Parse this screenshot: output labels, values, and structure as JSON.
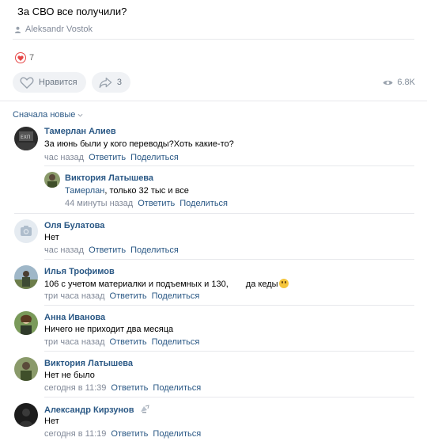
{
  "post": {
    "title": "За СВО все получили?",
    "author": "Aleksandr Vostok",
    "likes_count": "7",
    "like_label": "Нравится",
    "share_count": "3",
    "views": "6.8K"
  },
  "sort_label": "Сначала новые",
  "comments": [
    {
      "name": "Тамерлан Алиев",
      "text": "За июнь были у кого переводы?Хоть какие-то?",
      "time": "час назад",
      "reply": "Ответить",
      "share": "Поделиться"
    },
    {
      "name": "Виктория Латышева",
      "mention": "Тамерлан",
      "text": ", только 32 тыс и все",
      "time": "44 минуты назад",
      "reply": "Ответить",
      "share": "Поделиться"
    },
    {
      "name": "Оля Булатова",
      "text": "Нет",
      "time": "час назад",
      "reply": "Ответить",
      "share": "Поделиться"
    },
    {
      "name": "Илья Трофимов",
      "text": "106 с учетом материалки и подъемных и 130,",
      "text2": "да кеды",
      "time": "три часа назад",
      "reply": "Ответить",
      "share": "Поделиться"
    },
    {
      "name": "Анна Иванова",
      "text": "Ничего не приходит два месяца",
      "time": "три часа назад",
      "reply": "Ответить",
      "share": "Поделиться"
    },
    {
      "name": "Виктория Латышева",
      "text": "Нет не было",
      "time": "сегодня в 11:39",
      "reply": "Ответить",
      "share": "Поделиться"
    },
    {
      "name": "Александр Кирзунов",
      "text": "Нет",
      "time": "сегодня в 11:19",
      "reply": "Ответить",
      "share": "Поделиться"
    }
  ],
  "icons": {
    "author": "user-icon",
    "likes": "heart-icon",
    "share": "share-arrow-icon",
    "views": "eye-icon",
    "sort": "chevron-down-icon",
    "camera": "camera-icon"
  },
  "colors": {
    "link": "#2a5885",
    "muted": "#828a99",
    "like_red": "#e64646",
    "pill_bg": "#f0f2f5",
    "divider": "#e7e8ec"
  }
}
